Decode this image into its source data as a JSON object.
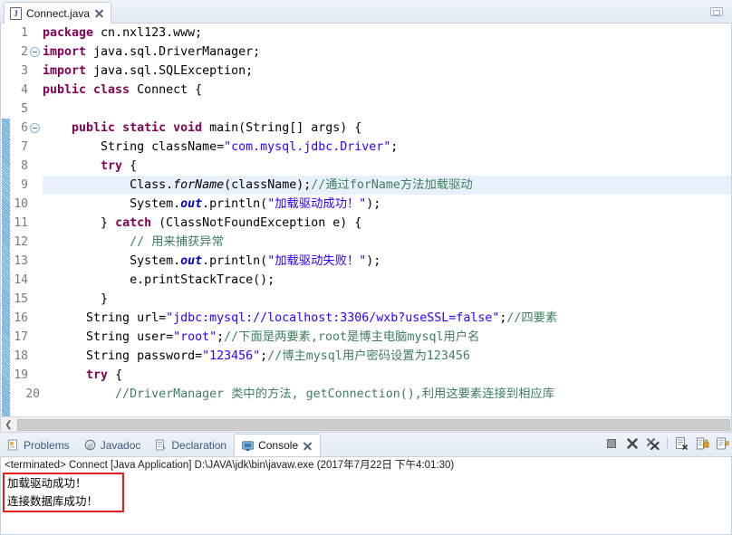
{
  "editor": {
    "tab": {
      "label": "Connect.java",
      "icon": "java-file-icon",
      "close_icon": "close-icon"
    },
    "minimize_icon": "minimize-icon",
    "gutter_numbers": [
      "1",
      "2",
      "3",
      "4",
      "5",
      "6",
      "7",
      "8",
      "9",
      "10",
      "11",
      "12",
      "13",
      "14",
      "15",
      "16",
      "17",
      "18",
      "19",
      "20"
    ],
    "fold_lines": [
      "2",
      "6"
    ],
    "highlighted_line": "9",
    "lines": [
      {
        "n": "1",
        "tokens": [
          {
            "t": "package ",
            "c": "kw"
          },
          {
            "t": "cn.nxl123.www;",
            "c": "pln"
          }
        ]
      },
      {
        "n": "2",
        "tokens": [
          {
            "t": "import ",
            "c": "kw"
          },
          {
            "t": "java.sql.DriverManager;",
            "c": "pln"
          }
        ]
      },
      {
        "n": "3",
        "tokens": [
          {
            "t": "import ",
            "c": "kw"
          },
          {
            "t": "java.sql.SQLException;",
            "c": "pln"
          }
        ]
      },
      {
        "n": "4",
        "tokens": [
          {
            "t": "public class ",
            "c": "kw"
          },
          {
            "t": "Connect {",
            "c": "pln"
          }
        ]
      },
      {
        "n": "5",
        "tokens": [
          {
            "t": "",
            "c": "pln"
          }
        ]
      },
      {
        "n": "6",
        "tokens": [
          {
            "t": "    ",
            "c": "pln"
          },
          {
            "t": "public static void ",
            "c": "kw"
          },
          {
            "t": "main(String[] args) {",
            "c": "pln"
          }
        ]
      },
      {
        "n": "7",
        "tokens": [
          {
            "t": "        String className=",
            "c": "pln"
          },
          {
            "t": "\"com.mysql.jdbc.Driver\"",
            "c": "str"
          },
          {
            "t": ";",
            "c": "pln"
          }
        ]
      },
      {
        "n": "8",
        "tokens": [
          {
            "t": "        ",
            "c": "pln"
          },
          {
            "t": "try ",
            "c": "kw"
          },
          {
            "t": "{",
            "c": "pln"
          }
        ]
      },
      {
        "n": "9",
        "tokens": [
          {
            "t": "            Class.",
            "c": "pln"
          },
          {
            "t": "forName",
            "c": "mth"
          },
          {
            "t": "(className);",
            "c": "pln"
          },
          {
            "t": "//通过forName方法加载驱动",
            "c": "cmt"
          }
        ]
      },
      {
        "n": "10",
        "tokens": [
          {
            "t": "            System.",
            "c": "pln"
          },
          {
            "t": "out",
            "c": "fld"
          },
          {
            "t": ".println(",
            "c": "pln"
          },
          {
            "t": "\"加载驱动成功！\"",
            "c": "str"
          },
          {
            "t": ");",
            "c": "pln"
          }
        ]
      },
      {
        "n": "11",
        "tokens": [
          {
            "t": "        } ",
            "c": "pln"
          },
          {
            "t": "catch ",
            "c": "kw"
          },
          {
            "t": "(ClassNotFoundException e) {",
            "c": "pln"
          }
        ]
      },
      {
        "n": "12",
        "tokens": [
          {
            "t": "            ",
            "c": "pln"
          },
          {
            "t": "// 用来捕获异常",
            "c": "cmt"
          }
        ]
      },
      {
        "n": "13",
        "tokens": [
          {
            "t": "            System.",
            "c": "pln"
          },
          {
            "t": "out",
            "c": "fld"
          },
          {
            "t": ".println(",
            "c": "pln"
          },
          {
            "t": "\"加载驱动失败！\"",
            "c": "str"
          },
          {
            "t": ");",
            "c": "pln"
          }
        ]
      },
      {
        "n": "14",
        "tokens": [
          {
            "t": "            e.printStackTrace();",
            "c": "pln"
          }
        ]
      },
      {
        "n": "15",
        "tokens": [
          {
            "t": "        }",
            "c": "pln"
          }
        ]
      },
      {
        "n": "16",
        "tokens": [
          {
            "t": "      String url=",
            "c": "pln"
          },
          {
            "t": "\"jdbc:mysql://localhost:3306/wxb?useSSL=false\"",
            "c": "str"
          },
          {
            "t": ";",
            "c": "pln"
          },
          {
            "t": "//四要素",
            "c": "cmt"
          }
        ]
      },
      {
        "n": "17",
        "tokens": [
          {
            "t": "      String user=",
            "c": "pln"
          },
          {
            "t": "\"root\"",
            "c": "str"
          },
          {
            "t": ";",
            "c": "pln"
          },
          {
            "t": "//下面是两要素,root是博主电脑mysql用户名",
            "c": "cmt"
          }
        ]
      },
      {
        "n": "18",
        "tokens": [
          {
            "t": "      String password=",
            "c": "pln"
          },
          {
            "t": "\"123456\"",
            "c": "str"
          },
          {
            "t": ";",
            "c": "pln"
          },
          {
            "t": "//博主mysql用户密码设置为123456",
            "c": "cmt"
          }
        ]
      },
      {
        "n": "19",
        "tokens": [
          {
            "t": "      ",
            "c": "pln"
          },
          {
            "t": "try ",
            "c": "kw"
          },
          {
            "t": "{",
            "c": "pln"
          }
        ]
      }
    ],
    "hscroll": {
      "left_arrow": "scroll-left-icon"
    }
  },
  "console": {
    "tabs": [
      {
        "label": "Problems",
        "icon": "problems-icon",
        "active": false,
        "closable": false
      },
      {
        "label": "Javadoc",
        "icon": "javadoc-icon",
        "active": false,
        "closable": false
      },
      {
        "label": "Declaration",
        "icon": "declaration-icon",
        "active": false,
        "closable": false
      },
      {
        "label": "Console",
        "icon": "console-icon",
        "active": true,
        "closable": true
      }
    ],
    "toolbar": [
      {
        "name": "terminate-button"
      },
      {
        "name": "remove-launch-button"
      },
      {
        "name": "remove-all-terminated-button"
      },
      {
        "name": "clear-console-button"
      },
      {
        "name": "scroll-lock-button"
      },
      {
        "name": "word-wrap-button"
      }
    ],
    "status_line": "<terminated> Connect [Java Application] D:\\JAVA\\jdk\\bin\\javaw.exe (2017年7月22日 下午4:01:30)",
    "output": [
      "加载驱动成功！",
      "连接数据库成功！"
    ],
    "highlight_color": "#ee1c1c"
  },
  "colors": {
    "keyword": "#7f0055",
    "string": "#2a00ff",
    "comment": "#3f7f5f",
    "field": "#0000c0",
    "highlight_line": "#e8f1fb",
    "tab_bar": "#e6eef7"
  }
}
